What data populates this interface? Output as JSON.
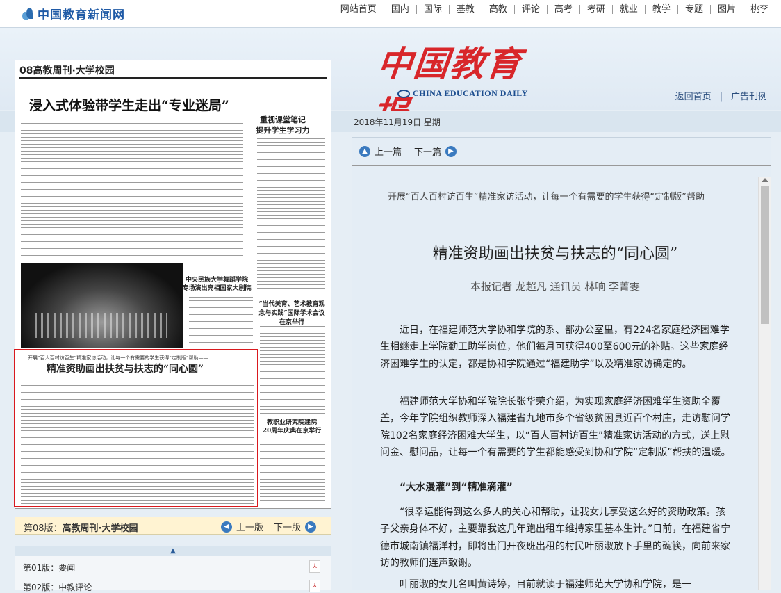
{
  "site": {
    "logo_text": "中国教育新闻网"
  },
  "nav": [
    "网站首页",
    "国内",
    "国际",
    "基教",
    "高教",
    "评论",
    "高考",
    "考研",
    "就业",
    "教学",
    "专题",
    "图片",
    "桃李"
  ],
  "masthead": {
    "cn": "中国教育报",
    "en": "CHINA EDUCATION DAILY"
  },
  "header_links": {
    "home": "返回首页",
    "sep": "|",
    "ad": "广告刊例"
  },
  "date": "2018年11月19日  星期一",
  "paper": {
    "page_header": "08高教周刊·大学校园",
    "headline_top": "浸入式体验带学生走出“专业迷局”",
    "side_title": "重视课堂笔记\n提升学生学习力",
    "photo_title": "中央民族大学舞蹈学院\n专场演出亮相国家大剧院",
    "mid_right": "“当代美育、艺术教育观念与实践”国际学术会议在京举行",
    "bot_right": "教职业研究院建院\n20周年庆典在京举行",
    "hl_kicker": "开展“百人百村访百生”精准家访活动，让每一个有需要的学生获得“定制版”帮助——",
    "hl_title": "精准资助画出扶贫与扶志的“同心圆”"
  },
  "page_nav": {
    "label": "第08版：",
    "name": "高教周刊·大学校园",
    "prev": "上一版",
    "next": "下一版"
  },
  "page_list": [
    {
      "label": "第01版：要闻"
    },
    {
      "label": "第02版：中教评论"
    }
  ],
  "article_nav": {
    "prev": "上一篇",
    "next": "下一篇"
  },
  "article": {
    "kicker": "开展“百人百村访百生”精准家访活动，让每一个有需要的学生获得“定制版”帮助——",
    "title": "精准资助画出扶贫与扶志的“同心圆”",
    "byline": "本报记者  龙超凡  通讯员  林响  李菁雯",
    "p1": "近日，在福建师范大学协和学院的系、部办公室里，有224名家庭经济困难学生相继走上学院勤工助学岗位，他们每月可获得400至600元的补贴。这些家庭经济困难学生的认定，都是协和学院通过“福建助学”以及精准家访确定的。",
    "p2": "福建师范大学协和学院院长张华荣介绍，为实现家庭经济困难学生资助全覆盖，今年学院组织教师深入福建省九地市多个省级贫困县近百个村庄，走访慰问学院102名家庭经济困难大学生，以“百人百村访百生”精准家访活动的方式，送上慰问金、慰问品，让每一个有需要的学生都能感受到协和学院“定制版”帮扶的温暖。",
    "subhead": "“大水漫灌”到“精准滴灌”",
    "p3": "“很幸运能得到这么多人的关心和帮助，让我女儿享受这么好的资助政策。孩子父亲身体不好，主要靠我这几年跑出租车维持家里基本生计。”日前，在福建省宁德市城南镇福洋村，即将出门开夜班出租的村民叶丽淑放下手里的碗筷，向前来家访的教师们连声致谢。",
    "p4": "叶丽淑的女儿名叫黄诗婷，目前就读于福建师范大学协和学院，是一"
  }
}
